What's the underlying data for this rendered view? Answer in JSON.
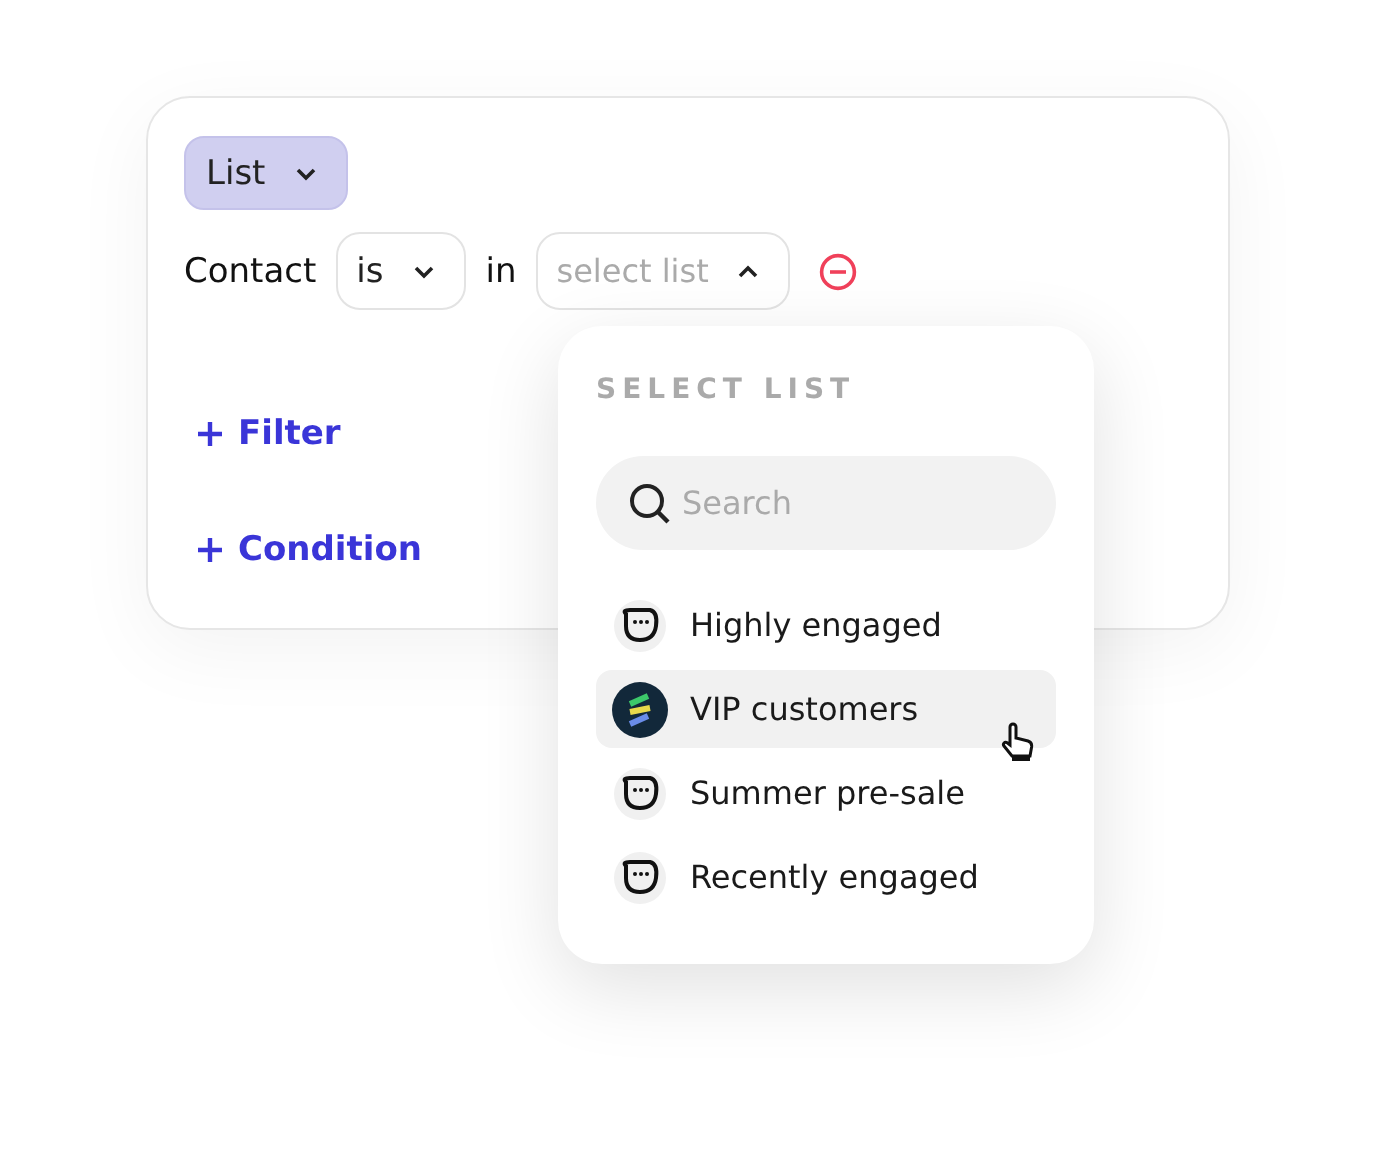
{
  "type_select": {
    "label": "List"
  },
  "condition": {
    "field": "Contact",
    "operator": "is",
    "connector": "in",
    "list_placeholder": "select list",
    "open": true
  },
  "actions": [
    {
      "label": "Filter"
    },
    {
      "label": "Condition"
    }
  ],
  "dropdown": {
    "title": "SELECT LIST",
    "search": {
      "placeholder": "Search"
    },
    "items": [
      {
        "label": "Highly engaged",
        "kind": "avatar",
        "selected": false
      },
      {
        "label": "VIP customers",
        "kind": "logo",
        "selected": true
      },
      {
        "label": "Summer pre-sale",
        "kind": "avatar",
        "selected": false
      },
      {
        "label": "Recently engaged",
        "kind": "avatar",
        "selected": false
      }
    ]
  }
}
